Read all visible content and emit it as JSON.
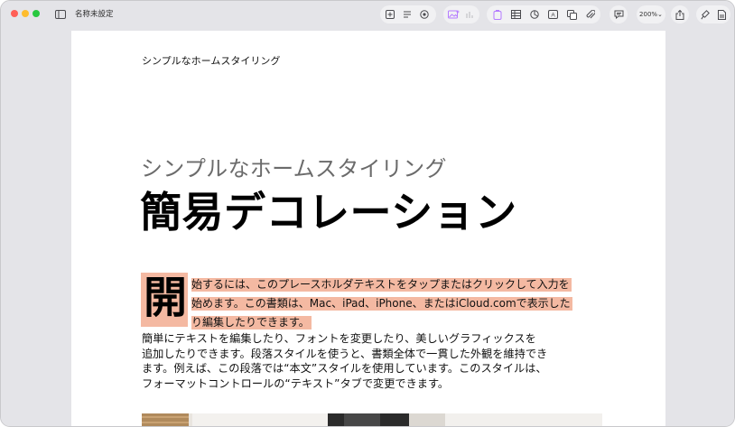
{
  "window": {
    "title": "名称未設定"
  },
  "toolbar": {
    "zoom_label": "200%⌄",
    "icons": [
      "sidebar-icon",
      "add-page-icon",
      "text-box-icon",
      "collaborate-icon",
      "image-insert-icon",
      "chart-icon",
      "page-icon",
      "table-icon",
      "chart-pie-icon",
      "text-icon",
      "shape-icon",
      "attachment-icon",
      "comment-icon",
      "share-icon",
      "format-icon",
      "document-icon"
    ]
  },
  "document": {
    "running_head": "シンプルなホームスタイリング",
    "subtitle": "シンプルなホームスタイリング",
    "title": "簡易デコレーション",
    "drop_cap": "開",
    "highlight_lines": [
      "始するには、このプレースホルダテキストをタップまたはクリックして入力を",
      "始めます。この書類は、Mac、iPad、iPhone、またはiCloud.comで表示した",
      "り編集したりできます。"
    ],
    "body_lines": [
      "簡単にテキストを編集したり、フォントを変更したり、美しいグラフィックスを",
      "追加したりできます。段落スタイルを使うと、書類全体で一貫した外観を維持でき",
      "ます。例えば、この段落では“本文”スタイルを使用しています。このスタイルは、",
      "フォーマットコントロールの“テキスト”タブで変更できます。"
    ]
  },
  "colors": {
    "highlight": "#f4b9a2",
    "accent": "#b57cff",
    "chrome": "#e4e4e8"
  }
}
